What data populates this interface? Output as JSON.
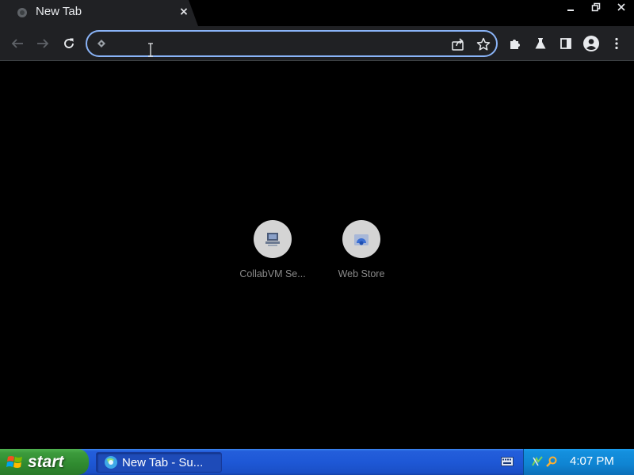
{
  "browser": {
    "tab": {
      "title": "New Tab",
      "favicon": "page-icon",
      "close": "×"
    },
    "window_controls": [
      "minimize-icon",
      "restore-icon",
      "close-icon"
    ],
    "toolbar": {
      "back": "arrow-left-icon",
      "forward": "arrow-right-icon",
      "reload": "reload-icon",
      "omnibox": {
        "value": "",
        "placeholder": ""
      },
      "actions": [
        "share-icon",
        "star-icon"
      ],
      "extensions": [
        "puzzle-icon",
        "flask-icon",
        "side-panel-icon",
        "profile-icon",
        "menu-icon"
      ]
    },
    "accent": "#8ab4f8"
  },
  "newtab": {
    "shortcuts": [
      {
        "label": "CollabVM Se...",
        "icon": "collabvm-icon"
      },
      {
        "label": "Web Store",
        "icon": "web-store-icon"
      }
    ]
  },
  "taskbar": {
    "start_label": "start",
    "task": {
      "label": "New Tab - Su...",
      "icon": "browser-icon"
    },
    "clock": "4:07 PM",
    "colors": {
      "taskbar": "#245edb",
      "start": "#3c9b3c",
      "tray": "#0f84d2"
    }
  }
}
